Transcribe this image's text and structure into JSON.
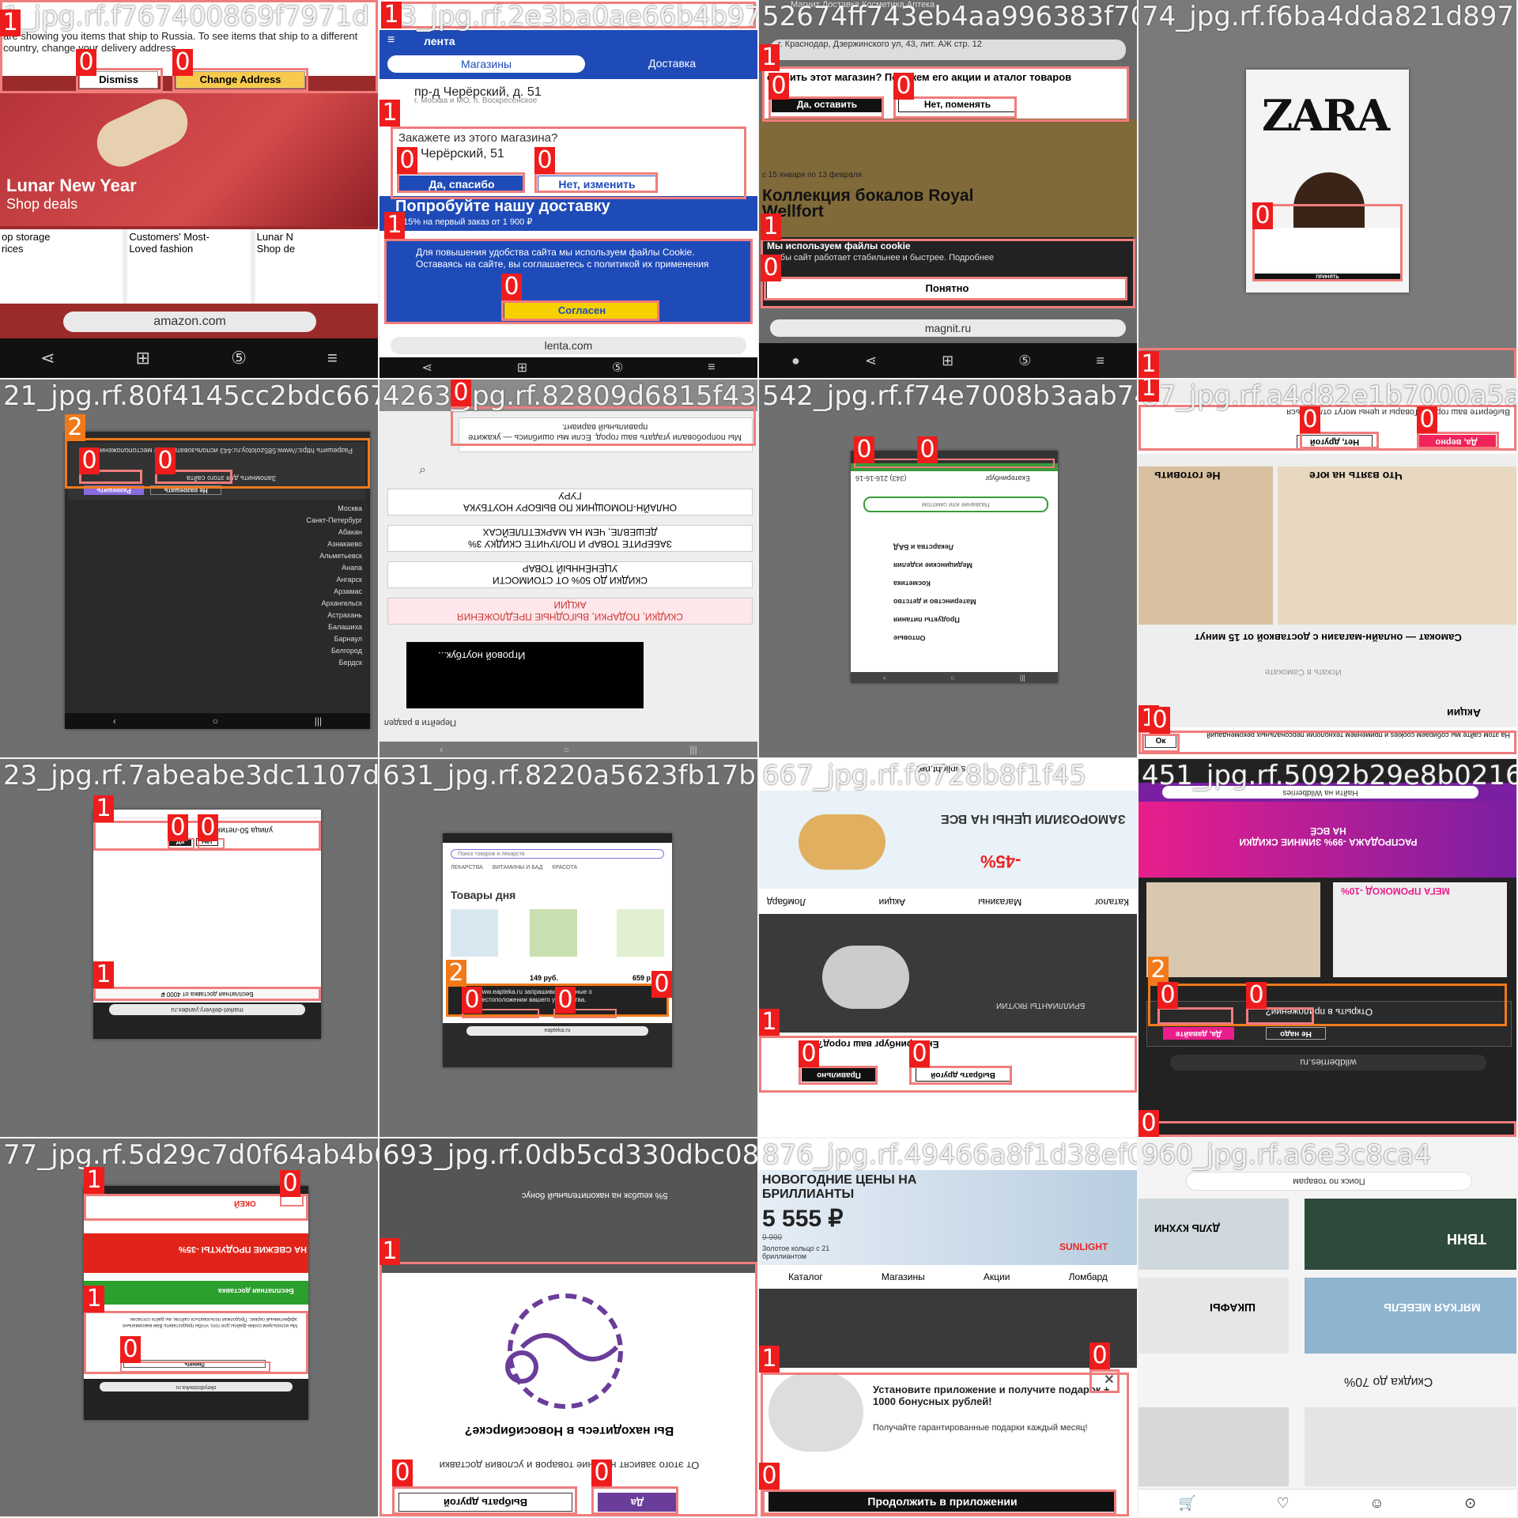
{
  "tiles": [
    {
      "filename": "1_jpg.rf.f767400869f7971d",
      "banner": "are showing you items that ship to Russia. To see items that ship to a different country, change your delivery address.",
      "dismiss": "Dismiss",
      "change_address": "Change Address",
      "promo_title": "Lunar New Year",
      "promo_sub": "Shop deals",
      "cards": [
        "op storage\nrices",
        "Customers' Most-\nLoved fashion",
        "Lunar N\nShop de"
      ],
      "url": "amazon.com"
    },
    {
      "filename": "13_jpg.rf.2e3ba0ae66b4b97f",
      "logo": "лента",
      "tab_shops": "Магазины",
      "tab_delivery": "Доставка",
      "address": "пр-д Черёрский, д. 51",
      "address_sub": "г. Москва и МО, п. Воскресенское",
      "question": "Закажете из этого магазина?",
      "store": "р-д Черёрский, 51",
      "yes": "Да, спасибо",
      "no": "Нет, изменить",
      "promo": "Попробуйте нашу доставку",
      "promo_sub": "15% на первый заказ от 1 900 ₽",
      "cookie": "Для повышения удобства сайта мы используем файлы Cookie. Оставаясь на сайте, вы соглашаетесь с политикой их применения",
      "agree": "Согласен",
      "url": "lenta.com"
    },
    {
      "filename": "52674ff743eb4aa996383f70ea",
      "top_tabs": "Магнит   Доставка   Косметика   Аптека",
      "address": "г. Краснодар, Дзержинского ул, 43, лит. АЖ стр. 12",
      "question": "ставить этот магазин? Покажем его акции и аталог товаров",
      "yes": "Да, оставить",
      "no": "Нет, поменять",
      "dates": "с 15 января по 13 февраля",
      "collection": "Коллекция бокалов Royal Wellfort",
      "cookie_title": "Мы используем файлы cookie",
      "cookie_text": "чтобы сайт работает стабильнее и быстрее. Подробнее",
      "ok": "Понятно",
      "url": "magnit.ru"
    },
    {
      "filename": "74_jpg.rf.f6ba4dda821d897",
      "logo": "ZARA",
      "ok": "ПРИНЯТЬ"
    },
    {
      "filename": "21_jpg.rf.80f4145cc2bdc667",
      "perm": "Разрешить https://www.585zolotoy.ru:443 использовать ваше местоположение?",
      "remember": "Запомнить для этого сайта",
      "allow": "Разрешить",
      "deny": "Не разрешать",
      "cities": [
        "Москва",
        "Санкт-Петербург",
        "",
        "Абакан",
        "Азнакаево",
        "Альметьевск",
        "Анапа",
        "Ангарск",
        "Арзамас",
        "Архангельск",
        "Астрахань",
        "Балашиха",
        "Барнаул",
        "Белгород",
        "Бердск"
      ]
    },
    {
      "filename": "4263_jpg.rf.82809d6815f43",
      "notice": "Мы попробовали угадать ваш город. Если мы ошиблись — укажите правильный вариант.",
      "items": [
        "ГУРУ",
        "ОНЛАЙН-ПОМОЩНИК ПО ВЫБОРУ НОУТБУКА",
        "ДЕШЕВЛЕ, ЧЕМ НА МАРКЕТПЛЕЙСАХ",
        "ЗАБЕРИТЕ ТОВАР И ПОЛУЧИТЕ СКИДКУ 3%",
        "УЦЕНЁННЫЙ ТОВАР",
        "СКИДКИ ДО 50% ОТ СТОИМОСТИ",
        "АКЦИИ",
        "СКИДКИ, ПОДАРКИ, ВЫГОДНЫЕ ПРЕДЛОЖЕНИЯ"
      ],
      "video": "Игровой ноутбук...",
      "link": "Перейти в раздел"
    },
    {
      "filename": "542_jpg.rf.f74e7008b3aab7442",
      "city": "Екатеринбург",
      "phone": "(343) 216-16-16",
      "search": "Название или симптом",
      "menu": [
        "Лекарства и БАД",
        "Медицинские изделия",
        "Косметика",
        "Материнство и детство",
        "Продукты питания",
        "Оптовые"
      ]
    },
    {
      "filename": "87_jpg.rf.a4d82e1b7000a5a3b9",
      "question": "Выберите ваш город? Товары и цены могут отличаться",
      "yes": "Да, верно",
      "no": "Нет, другой",
      "cat1": "Не готовить",
      "cat2": "Что взять на юге",
      "promo": "Самокат — онлайн-магазин с доставкой от 15 минут",
      "search": "Искать в Самокате",
      "akcii": "Акции",
      "cookie": "На этом сайте мы собираем cookies и применяем технологии персональных рекомендаций",
      "ok": "Ок"
    },
    {
      "filename": "23_jpg.rf.7abeabe3dc1107d4",
      "q": "улица 50-летия?",
      "yes": "Да",
      "no": "Нет",
      "bottom": "Бесплатная доставка от 4000 ₽",
      "url": "market-delivery.yandex.ru"
    },
    {
      "filename": "631_jpg.rf.8220a5623fb17b84c",
      "search": "Поиск товаров и лекарств",
      "tabs": [
        "ЛЕКАРСТВА",
        "ВИТАМИНЫ И БАД",
        "КРАСОТА"
      ],
      "title": "Товары дня",
      "price1": "149 руб.",
      "price2": "659 р",
      "notice": "www.eapteka.ru запрашивает данные о местоположении вашего устройства.",
      "url": "eapteka.ru"
    },
    {
      "filename": "667_jpg.rf.f6728b8f1f45",
      "top": "sunlight.net",
      "promo1": "ЗАМОРОЗИЛИ ЦЕНЫ НА ВСЕ",
      "promo2": "-45%",
      "tabs": [
        "Каталог",
        "Магазины",
        "Акции",
        "Ломбард"
      ],
      "q": "Екатеринбург ваш город?",
      "yes": "Правильно",
      "no": "Выбрать другой",
      "brand": "БРИЛЛИАНТЫ ЯКУТИИ"
    },
    {
      "filename": "451_jpg.rf.5092b29e8b0216f1dc54",
      "search": "Найти на Wildberries",
      "promo": "РАСПРОДАЖА -99% ЗИМНИЕ СКИДКИ НА ВСЁ",
      "promo2": "МЕГА ПРОМОКОД -10%",
      "q": "Открыть в приложении?",
      "yes": "Да, давайте",
      "no": "Не надо",
      "url": "wildberries.ru"
    },
    {
      "filename": "77_jpg.rf.5d29c7d0f64ab4b6",
      "brand": "ОКЕЙ",
      "promo": "НА СВЕЖИЕ ПРОДУКТЫ -35%",
      "delivery": "Бесплатная доставка",
      "cookie": "Мы используем cookie-файлы для того, чтобы предоставить Вам максимально эффективный сервис. Продолжая пользоваться сайтом, вы даёте согласие.",
      "ok": "Принять",
      "url": "okeydostavka.ru"
    },
    {
      "filename": "693_jpg.rf.0db5cd330dbc087",
      "promo": "5% кешбэк на накопительный бонус",
      "q": "Вы находитесь в Новосибирске?",
      "text": "От этого зависят наличие товаров и условия доставки",
      "yes": "Да",
      "no": "Выбрать другой"
    },
    {
      "filename": "876_jpg.rf.49466a8f1d38ef0a8",
      "title": "НОВОГОДНИЕ ЦЕНЫ НА БРИЛЛИАНТЫ",
      "price": "5 555 ₽",
      "old": "9 990",
      "desc": "Золотое кольцо с 21 бриллиантом",
      "tabs": [
        "Каталог",
        "Магазины",
        "Акции",
        "Ломбард"
      ],
      "app_title": "Установите приложение и получите подарок + 1000 бонусных рублей!",
      "app_sub": "Получайте гарантированные подарки каждый месяц!",
      "cta": "Продолжить в приложении",
      "brand": "SUNLIGHT"
    },
    {
      "filename": "960_jpg.rf.a6e3c8ca4",
      "search": "Поиск по товарам",
      "cards": [
        "ДУЛЬ КУХНИ",
        "ТВНН",
        "ШКАФЫ",
        "МЯГКАЯ МЕБЕЛЬ"
      ],
      "sale": "Скидка до 70%"
    }
  ],
  "labels": {
    "c0": "0",
    "c1": "1",
    "c2": "2"
  },
  "colors": {
    "box": "#f07c7c",
    "tag": "#ee1c1c",
    "tag_alt": "#f27a1a"
  }
}
